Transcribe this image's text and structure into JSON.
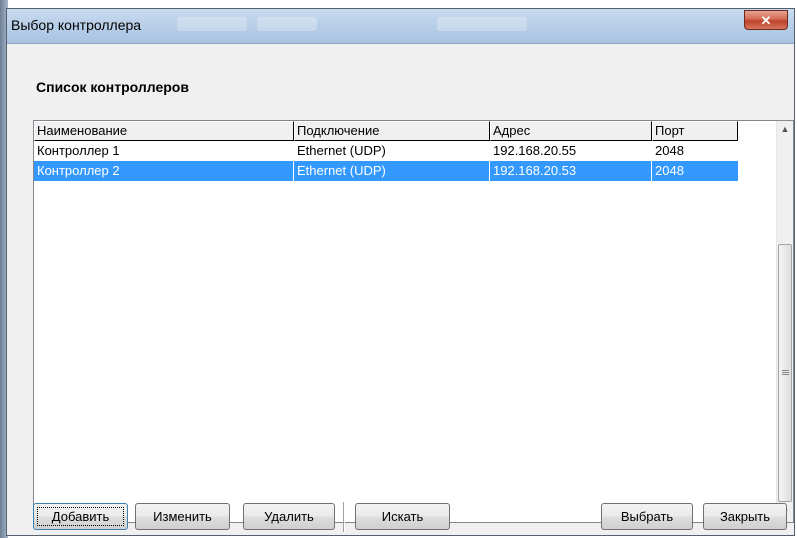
{
  "window": {
    "title": "Выбор контроллера",
    "close_glyph": "✕"
  },
  "section": {
    "title": "Список контроллеров"
  },
  "table": {
    "columns": [
      "Наименование",
      "Подключение",
      "Адрес",
      "Порт"
    ],
    "rows": [
      {
        "name": "Контроллер 1",
        "connection": "Ethernet (UDP)",
        "address": "192.168.20.55",
        "port": "2048",
        "selected": false
      },
      {
        "name": "Контроллер 2",
        "connection": "Ethernet (UDP)",
        "address": "192.168.20.53",
        "port": "2048",
        "selected": true
      }
    ]
  },
  "scrollbar": {
    "up_icon": "▲",
    "down_icon": "▼",
    "grip_glyph": "≡"
  },
  "buttons": {
    "add": "Добавить",
    "edit": "Изменить",
    "delete": "Удалить",
    "search": "Искать",
    "select": "Выбрать",
    "close": "Закрыть"
  },
  "colors": {
    "selection": "#3399ff",
    "titlebar": "#b9cfe8",
    "close_button": "#c0432b"
  }
}
